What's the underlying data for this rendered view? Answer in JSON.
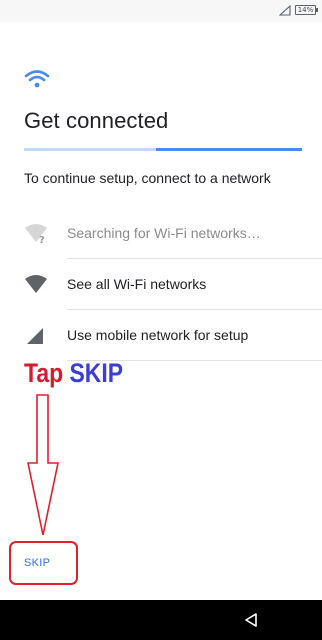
{
  "status_bar": {
    "battery_label": "14%",
    "icons": [
      "signal-outline-icon",
      "battery-icon"
    ]
  },
  "header": {
    "icon": "wifi-icon",
    "title": "Get connected",
    "progress": 0.47,
    "subtitle": "To continue setup, connect to a network"
  },
  "options": [
    {
      "icon": "wifi-searching-icon",
      "label": "Searching for Wi-Fi networks…",
      "disabled": true
    },
    {
      "icon": "wifi-icon",
      "label": "See all Wi-Fi networks"
    },
    {
      "icon": "cellular-signal-icon",
      "label": "Use mobile network for setup"
    }
  ],
  "annotation": {
    "tap": "Tap",
    "skip": "SKIP"
  },
  "footer": {
    "skip_label": "SKIP"
  },
  "nav_bar": {
    "icons": [
      "back-icon"
    ]
  },
  "colors": {
    "accent": "#4a8af2",
    "annotation_red": "#d11d2e",
    "annotation_blue": "#3b3fd1",
    "nav_bar": "#000000"
  }
}
